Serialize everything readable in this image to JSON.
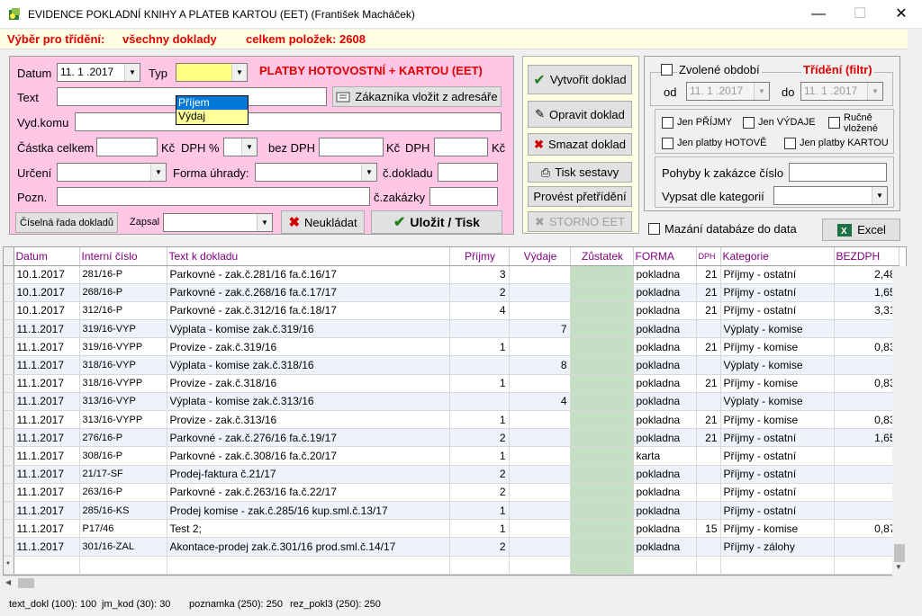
{
  "window": {
    "title": "EVIDENCE POKLADNÍ KNIHY A PLATEB KARTOU (EET)  (František Macháček)"
  },
  "filterbar": {
    "label": "Výběr pro třídění:",
    "value": "všechny doklady",
    "count": "celkem položek: 2608"
  },
  "form": {
    "datum_label": "Datum",
    "datum_value": "11. 1 .2017",
    "typ_label": "Typ",
    "typ_value": "",
    "typ_options": [
      "Příjem",
      "Výdaj"
    ],
    "heading": "PLATBY HOTOVOSTNÍ + KARTOU (EET)",
    "text_label": "Text",
    "zakaznik_button": "Zákazníka vložit z adresáře",
    "vydkomu_label": "Vyd.komu",
    "castka_label": "Částka celkem",
    "kc1": "Kč",
    "dph_pct_label": "DPH %",
    "bezdph_label": "bez DPH",
    "kc2": "Kč",
    "dph_label": "DPH",
    "kc3": "Kč",
    "urceni_label": "Určení",
    "forma_label": "Forma úhrady:",
    "cdokladu_label": "č.dokladu",
    "pozn_label": "Pozn.",
    "czakazky_label": "č.zakázky",
    "ciselna_button": "Číselná řada dokladů",
    "zapsal_label": "Zapsal",
    "neukladat_button": "Neukládat",
    "ulozit_button": "Uložit / Tisk"
  },
  "actions": {
    "vytvorit": "Vytvořit doklad",
    "opravit": "Opravit doklad",
    "smazat": "Smazat doklad",
    "tisk": "Tisk sestavy",
    "pretrideni": "Provést přetřídění",
    "storno": "STORNO EET"
  },
  "filters": {
    "obdobi_label": "Zvolené období",
    "trideni_label": "Třídění (filtr)",
    "od_label": "od",
    "od_value": "11. 1 .2017",
    "do_label": "do",
    "do_value": "11. 1 .2017",
    "jen_prijmy": "Jen PŘÍJMY",
    "jen_vydaje": "Jen VÝDAJE",
    "rucne": "Ručně vložené",
    "jen_hotove": "Jen platby HOTOVĚ",
    "jen_kartou": "Jen platby KARTOU",
    "pohyby_label": "Pohyby k zakázce číslo",
    "vypsat_label": "Vypsat dle kategorií",
    "mazani_label": "Mazání databáze do data",
    "excel_button": "Excel"
  },
  "colors": {
    "accent_red": "#e00000",
    "form_bg": "#ffc6e6",
    "header_text": "#800080",
    "zustatek_bg": "#c4dfc4"
  },
  "table": {
    "headers": [
      "Datum",
      "Interní číslo",
      "Text k dokladu",
      "Příjmy",
      "Výdaje",
      "Zůstatek",
      "FORMA",
      "DPH",
      "Kategorie",
      "BEZDPH"
    ],
    "rows": [
      [
        "10.1.2017",
        "281/16-P",
        "Parkovné - zak.č.281/16 fa.č.16/17",
        "3",
        "",
        "",
        "pokladna",
        "21",
        "Příjmy - ostatní",
        "2,48"
      ],
      [
        "10.1.2017",
        "268/16-P",
        "Parkovné - zak.č.268/16 fa.č.17/17",
        "2",
        "",
        "",
        "pokladna",
        "21",
        "Příjmy - ostatní",
        "1,65"
      ],
      [
        "10.1.2017",
        "312/16-P",
        "Parkovné - zak.č.312/16 fa.č.18/17",
        "4",
        "",
        "",
        "pokladna",
        "21",
        "Příjmy - ostatní",
        "3,31"
      ],
      [
        "11.1.2017",
        "319/16-VYP",
        "Výplata - komise zak.č.319/16",
        "",
        "7",
        "",
        "pokladna",
        "",
        "Výplaty - komise",
        ""
      ],
      [
        "11.1.2017",
        "319/16-VYPP",
        "Provize - zak.č.319/16",
        "1",
        "",
        "",
        "pokladna",
        "21",
        "Příjmy - komise",
        "0,83"
      ],
      [
        "11.1.2017",
        "318/16-VYP",
        "Výplata - komise zak.č.318/16",
        "",
        "8",
        "",
        "pokladna",
        "",
        "Výplaty - komise",
        ""
      ],
      [
        "11.1.2017",
        "318/16-VYPP",
        "Provize - zak.č.318/16",
        "1",
        "",
        "",
        "pokladna",
        "21",
        "Příjmy - komise",
        "0,83"
      ],
      [
        "11.1.2017",
        "313/16-VYP",
        "Výplata - komise zak.č.313/16",
        "",
        "4",
        "",
        "pokladna",
        "",
        "Výplaty - komise",
        ""
      ],
      [
        "11.1.2017",
        "313/16-VYPP",
        "Provize - zak.č.313/16",
        "1",
        "",
        "",
        "pokladna",
        "21",
        "Příjmy - komise",
        "0,83"
      ],
      [
        "11.1.2017",
        "276/16-P",
        "Parkovné - zak.č.276/16 fa.č.19/17",
        "2",
        "",
        "",
        "pokladna",
        "21",
        "Příjmy - ostatní",
        "1,65"
      ],
      [
        "11.1.2017",
        "308/16-P",
        "Parkovné - zak.č.308/16 fa.č.20/17",
        "1",
        "",
        "",
        "karta",
        "",
        "Příjmy - ostatní",
        ""
      ],
      [
        "11.1.2017",
        "21/17-SF",
        "Prodej-faktura č.21/17",
        "2",
        "",
        "",
        "pokladna",
        "",
        "Příjmy - ostatní",
        ""
      ],
      [
        "11.1.2017",
        "263/16-P",
        "Parkovné - zak.č.263/16 fa.č.22/17",
        "2",
        "",
        "",
        "pokladna",
        "",
        "Příjmy - ostatní",
        ""
      ],
      [
        "11.1.2017",
        "285/16-KS",
        "Prodej komise - zak.č.285/16 kup.sml.č.13/17",
        "1",
        "",
        "",
        "pokladna",
        "",
        "Příjmy - ostatní",
        ""
      ],
      [
        "11.1.2017",
        "P17/46",
        "Test 2;",
        "1",
        "",
        "",
        "pokladna",
        "15",
        "Příjmy - komise",
        "0,87"
      ],
      [
        "11.1.2017",
        "301/16-ZAL",
        "Akontace-prodej zak.č.301/16 prod.sml.č.14/17",
        "2",
        "",
        "",
        "pokladna",
        "",
        "Příjmy - zálohy",
        ""
      ]
    ]
  },
  "status": {
    "s1": "text_dokl (100): 100",
    "s2": "jm_kod (30): 30",
    "s3": "poznamka (250): 250",
    "s4": "rez_pokl3 (250): 250"
  }
}
